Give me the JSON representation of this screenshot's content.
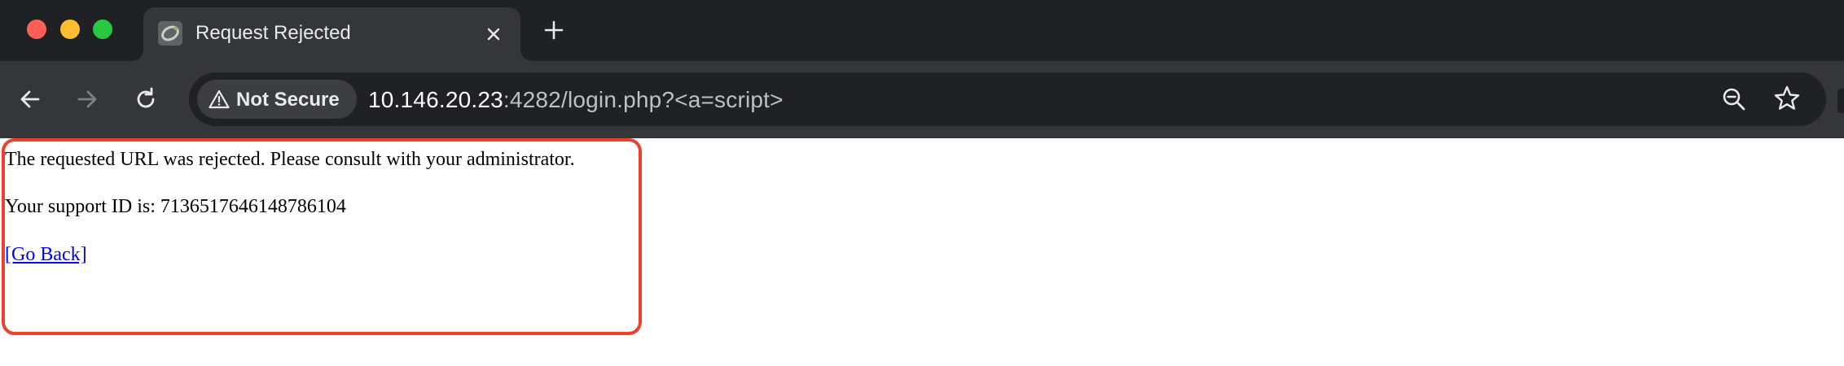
{
  "browser": {
    "tab": {
      "title": "Request Rejected",
      "favicon": "page-favicon-icon",
      "close_icon": "close-icon"
    },
    "new_tab_icon": "plus-icon",
    "nav": {
      "back_icon": "arrow-left-icon",
      "forward_icon": "arrow-right-icon",
      "reload_icon": "reload-icon"
    },
    "omnibox": {
      "security_label": "Not Secure",
      "security_icon": "warning-triangle-icon",
      "url_host": "10.146.20.23",
      "url_rest": ":4282/login.php?<a=script>",
      "zoom_icon": "zoom-out-icon",
      "bookmark_icon": "star-icon"
    },
    "colors": {
      "tabstrip_bg": "#202124",
      "toolbar_bg": "#35363a",
      "traffic_red": "#ff5f57",
      "traffic_yellow": "#febc2e",
      "traffic_green": "#28c840"
    }
  },
  "page": {
    "message": "The requested URL was rejected. Please consult with your administrator.",
    "support_id_line": "Your support ID is: 7136517646148786104",
    "go_back_link": "[Go Back]",
    "highlight_color": "#e8432f",
    "link_color": "#0000ee"
  }
}
